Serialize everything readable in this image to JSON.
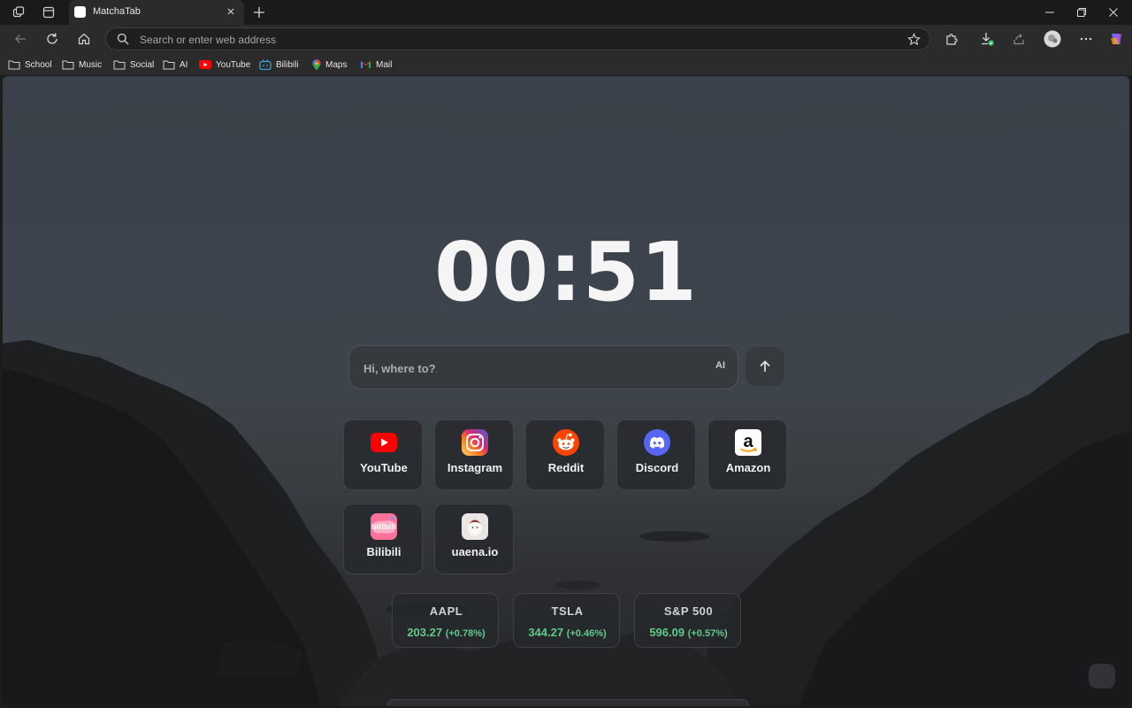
{
  "browser": {
    "tab_title": "MatchaTab",
    "address_placeholder": "Search or enter web address"
  },
  "bookmarks": [
    {
      "label": "School",
      "icon": "folder-icon"
    },
    {
      "label": "Music",
      "icon": "folder-icon"
    },
    {
      "label": "Social",
      "icon": "folder-icon"
    },
    {
      "label": "AI",
      "icon": "folder-icon"
    },
    {
      "label": "YouTube",
      "icon": "youtube-icon"
    },
    {
      "label": "Bilibili",
      "icon": "bilibili-icon"
    },
    {
      "label": "Maps",
      "icon": "maps-icon"
    },
    {
      "label": "Mail",
      "icon": "gmail-icon"
    }
  ],
  "clock": "00:51",
  "search": {
    "placeholder": "Hi, where to?",
    "ai_label": "AI"
  },
  "shortcuts": [
    {
      "label": "YouTube",
      "icon": "youtube-icon"
    },
    {
      "label": "Instagram",
      "icon": "instagram-icon"
    },
    {
      "label": "Reddit",
      "icon": "reddit-icon"
    },
    {
      "label": "Discord",
      "icon": "discord-icon"
    },
    {
      "label": "Amazon",
      "icon": "amazon-icon"
    },
    {
      "label": "Bilibili",
      "icon": "bilibili-icon"
    },
    {
      "label": "uaena.io",
      "icon": "uaena-icon"
    }
  ],
  "stocks": [
    {
      "symbol": "AAPL",
      "price": "203.27",
      "change": "(+0.78%)"
    },
    {
      "symbol": "TSLA",
      "price": "344.27",
      "change": "(+0.46%)"
    },
    {
      "symbol": "S&P 500",
      "price": "596.09",
      "change": "(+0.57%)"
    }
  ],
  "colors": {
    "positive": "#5fc98a",
    "youtube": "#ff0000",
    "reddit": "#ff4500",
    "discord": "#5865f2",
    "bilibili": "#fb7299"
  }
}
